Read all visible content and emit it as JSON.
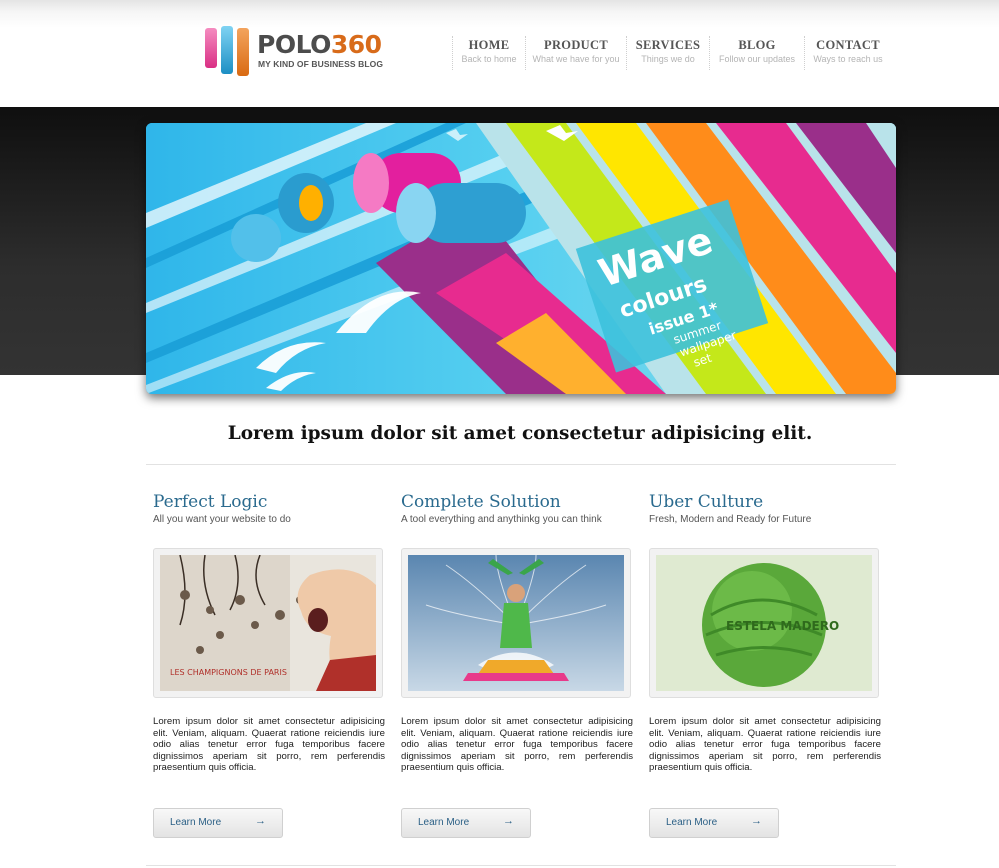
{
  "brand": {
    "name_main": "POLO",
    "name_accent": "360",
    "tagline": "MY KIND OF BUSINESS BLOG"
  },
  "nav": [
    {
      "label": "HOME",
      "sub": "Back to home"
    },
    {
      "label": "PRODUCT",
      "sub": "What we have for you"
    },
    {
      "label": "SERVICES",
      "sub": "Things we do"
    },
    {
      "label": "BLOG",
      "sub": "Follow our updates"
    },
    {
      "label": "CONTACT",
      "sub": "Ways to reach us"
    }
  ],
  "hero": {
    "line1": "Wave",
    "line2": "colours",
    "line3": "issue 1*",
    "line4": "summer",
    "line5": "wallpaper",
    "line6": "set"
  },
  "headline": "Lorem ipsum dolor sit amet consectetur adipisicing elit.",
  "columns": [
    {
      "title": "Perfect Logic",
      "subtitle": "All you want your website to do",
      "image_caption": "LES CHAMPIGNONS DE PARIS",
      "body": "Lorem ipsum dolor sit amet consectetur adipisicing elit. Veniam, aliquam. Quaerat ratione reiciendis iure odio alias tenetur error fuga temporibus facere dignissimos aperiam sit porro, rem perferendis praesentium quis officia.",
      "button": "Learn More",
      "arrow": "→"
    },
    {
      "title": "Complete Solution",
      "subtitle": "A tool everything and anythinkg you can think",
      "body": "Lorem ipsum dolor sit amet consectetur adipisicing elit. Veniam, aliquam. Quaerat ratione reiciendis iure odio alias tenetur error fuga temporibus facere dignissimos aperiam sit porro, rem perferendis praesentium quis officia.",
      "button": "Learn More",
      "arrow": "→"
    },
    {
      "title": "Uber Culture",
      "subtitle": "Fresh, Modern and Ready for Future",
      "image_caption": "ESTELA MADERO",
      "body": "Lorem ipsum dolor sit amet consectetur adipisicing elit. Veniam, aliquam. Quaerat ratione reiciendis iure odio alias tenetur error fuga temporibus facere dignissimos aperiam sit porro, rem perferendis praesentium quis officia.",
      "button": "Learn More",
      "arrow": "→"
    }
  ],
  "colors": {
    "link_blue": "#2a6a8e",
    "brand_orange": "#d86b1a",
    "dark_band": "#1f1f1f"
  }
}
